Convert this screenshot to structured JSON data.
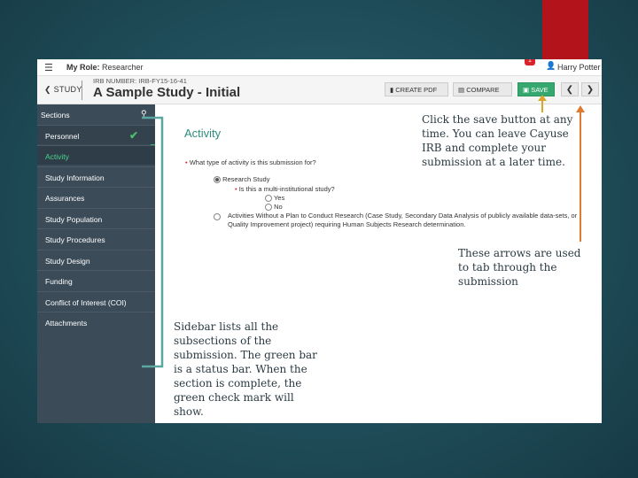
{
  "topbar": {
    "role_label": "My Role:",
    "role_value": "Researcher",
    "notification_count": "1",
    "user_name": "Harry Potter"
  },
  "studybar": {
    "back_label": "STUDY",
    "irb_number": "IRB NUMBER: IRB-FY15-16-41",
    "title": "A Sample Study - Initial",
    "create_pdf_label": "CREATE PDF",
    "compare_label": "COMPARE",
    "save_label": "SAVE",
    "prev_arrow": "❮",
    "next_arrow": "❯"
  },
  "sidebar": {
    "header": "Sections",
    "items": [
      {
        "label": "Personnel",
        "complete": true
      },
      {
        "label": "Activity",
        "active": true
      },
      {
        "label": "Study Information"
      },
      {
        "label": "Assurances"
      },
      {
        "label": "Study Population"
      },
      {
        "label": "Study Procedures"
      },
      {
        "label": "Study Design"
      },
      {
        "label": "Funding"
      },
      {
        "label": "Conflict of Interest (COI)"
      },
      {
        "label": "Attachments"
      }
    ]
  },
  "content": {
    "section_title": "Activity",
    "question1": "What type of activity is this submission for?",
    "option_research": "Research Study",
    "question2": "Is this a multi-institutional study?",
    "option_yes": "Yes",
    "option_no": "No",
    "option_activities": "Activities Without a Plan to Conduct Research (Case Study, Secondary Data Analysis of publicly available data-sets, or Quality Improvement project) requiring Human Subjects Research determination."
  },
  "annotations": {
    "save_note": "Click the save button at any time. You can leave Cayuse IRB and complete your submission at a later time.",
    "arrows_note": "These arrows are used to tab through the submission",
    "sidebar_note": "Sidebar lists all the subsections of the submission. The green bar is a status bar. When the section is complete, the green check mark will show."
  },
  "colors": {
    "background": "#1f4d59",
    "accent_red": "#b3141b",
    "sidebar_bg": "#3b4b58",
    "status_green": "#3fb56c",
    "save_button": "#35a76f",
    "section_title": "#2f8c7f",
    "annotation_arrow_save": "#d9a62b",
    "annotation_arrow_nav": "#e07a2e",
    "annotation_bracket": "#5ba6a0"
  },
  "icons": {
    "menu": "hamburger-icon",
    "user": "user-icon",
    "back": "chevron-left-icon",
    "pdf": "file-icon",
    "compare": "compare-icon",
    "save": "floppy-disk-icon",
    "pin": "pin-icon",
    "check": "check-icon"
  }
}
